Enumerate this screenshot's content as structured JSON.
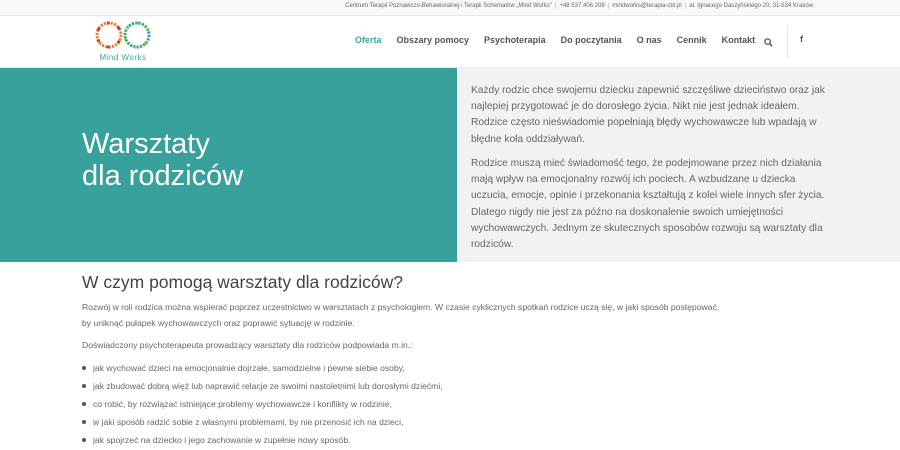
{
  "topbar": {
    "company": "Centrum Terapii Poznawczo-Behawioralnej i Terapii Schematów „Mind Works”",
    "phone": "+48 537 406 208",
    "email": "mindworks@terapia-cbt.pl",
    "address": "al. Ignacego Daszyńskiego 20, 31-534 Kraków"
  },
  "logo": {
    "text": "Mind Works"
  },
  "nav": {
    "items": [
      {
        "label": "Oferta",
        "active": true
      },
      {
        "label": "Obszary pomocy"
      },
      {
        "label": "Psychoterapia"
      },
      {
        "label": "Do poczytania"
      },
      {
        "label": "O nas"
      },
      {
        "label": "Cennik"
      },
      {
        "label": "Kontakt"
      }
    ],
    "search_icon": "search-icon",
    "social_icon": "facebook-icon",
    "social_label": "f"
  },
  "hero": {
    "title_line1": "Warsztaty",
    "title_line2": "dla rodziców",
    "paragraph1": "Każdy rodzic chce swojemu dziecku zapewnić szczęśliwe dzieciństwo oraz jak najlepiej przygotować je do dorosłego życia. Nikt nie jest jednak ideałem. Rodzice często nieświadomie popełniają błędy wychowawcze lub wpadają w błędne koła oddziaływań.",
    "paragraph2": "Rodzice muszą mieć świadomość tego, że podejmowane przez nich działania mają wpływ na emocjonalny rozwój ich pociech. A wzbudzane u dziecka uczucia, emocje, opinie i przekonania kształtują z kolei wiele innych sfer życia. Dlatego nigdy nie jest za późno na doskonalenie swoich umiejętności wychowawczych. Jednym ze skutecznych sposobów rozwoju są warsztaty dla rodziców."
  },
  "section": {
    "title": "W czym pomogą warsztaty dla rodziców?",
    "para1_line1": "Rozwój w roli rodzica można wspierać poprzez uczestnictwo w warsztatach z psychologiem. W czasie cyklicznych spotkań rodzice uczą się, w jaki sposób postępować,",
    "para1_line2": "by uniknąć pułapek wychowawczych oraz poprawić sytuację w rodzinie.",
    "para2": "Doświadczony psychoterapeuta prowadzący warsztaty dla rodziców podpowiada m.in.:",
    "bullets": [
      "jak wychować dzieci na emocjonalnie dojrzałe, samodzielne i pewne siebie osoby,",
      "jak zbudować dobrą więź lub naprawić relacje ze swoimi nastoletnimi lub dorosłymi dziećmi,",
      "co robić, by rozwiązać istniejące problemy wychowawcze i konflikty w rodzinie,",
      "w jaki sposób radzić sobie z własnymi problemami, by nie przenosić ich na dzieci,",
      "jak spojrzeć na dziecko i jego zachowanie w zupełnie nowy sposób."
    ]
  },
  "colors": {
    "accent": "#38a19c",
    "hero_right_bg": "#f2f2f2"
  }
}
